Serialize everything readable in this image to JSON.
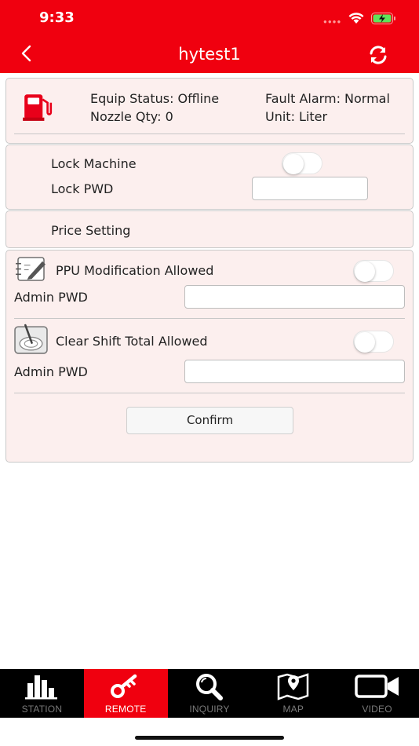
{
  "status_bar": {
    "time": "9:33"
  },
  "nav": {
    "title": "hytest1"
  },
  "device": {
    "equip_status": "Equip Status: Offline",
    "fault_alarm": "Fault Alarm: Normal",
    "nozzle_qty": "Nozzle Qty: 0",
    "unit": "Unit: Liter"
  },
  "lock": {
    "lock_machine_label": "Lock Machine",
    "lock_machine_on": false,
    "lock_pwd_label": "Lock PWD",
    "lock_pwd_value": ""
  },
  "price": {
    "label": "Price Setting"
  },
  "permissions": {
    "ppu_label": "PPU Modification Allowed",
    "ppu_on": false,
    "ppu_admin_label": "Admin PWD",
    "ppu_admin_value": "",
    "clear_label": "Clear Shift Total Allowed",
    "clear_on": false,
    "clear_admin_label": "Admin PWD",
    "clear_admin_value": "",
    "confirm_label": "Confirm"
  },
  "tabs": [
    {
      "label": "STATION",
      "icon": "bar-chart-icon",
      "active": false
    },
    {
      "label": "REMOTE",
      "icon": "key-icon",
      "active": true
    },
    {
      "label": "INQUIRY",
      "icon": "magnifier-icon",
      "active": false
    },
    {
      "label": "MAP",
      "icon": "map-pin-icon",
      "active": false
    },
    {
      "label": "VIDEO",
      "icon": "video-camera-icon",
      "active": false
    }
  ],
  "colors": {
    "brand_red": "#f0000f",
    "panel_bg": "#fcefee",
    "tabbar_bg": "#000000"
  }
}
